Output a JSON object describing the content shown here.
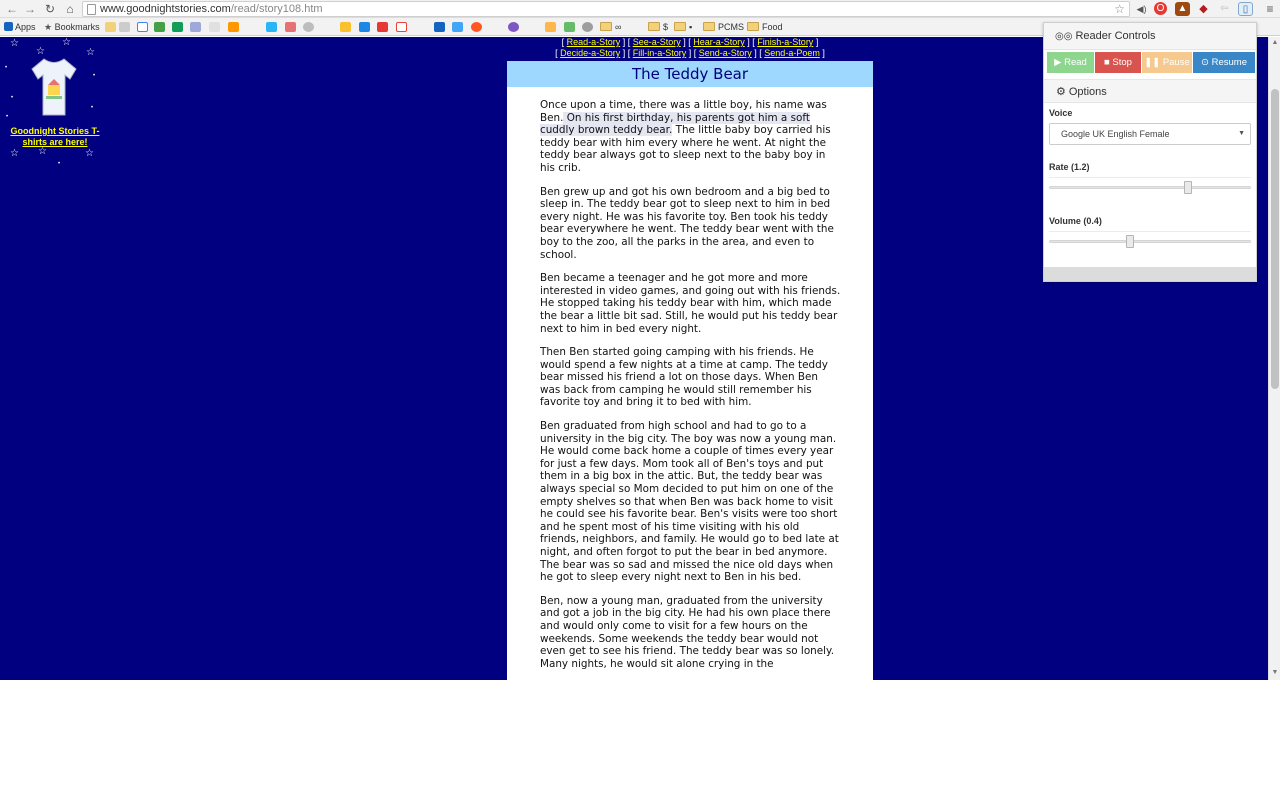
{
  "browser": {
    "url_domain": "www.goodnightstories.com",
    "url_path": "/read/story108.htm",
    "bookmarks": {
      "apps": "Apps",
      "bookmarks": "Bookmarks",
      "folder_dollar": "$",
      "folder_infinity": "∞",
      "folder_pcms": "PCMS",
      "folder_food": "Food"
    }
  },
  "sidebar": {
    "ad_text": "Goodnight Stories T-shirts are here!"
  },
  "nav": {
    "items": [
      "Read-a-Story",
      "See-a-Story",
      "Hear-a-Story",
      "Finish-a-Story",
      "Decide-a-Story",
      "Fill-in-a-Story",
      "Send-a-Story",
      "Send-a-Poem"
    ]
  },
  "story": {
    "title": "The Teddy Bear",
    "p1_a": "Once upon a time, there was a little boy, his name was Ben.",
    "p1_highlight": " On his first birthday, his parents got him a soft cuddly brown teddy bear.",
    "p1_b": " The little baby boy carried his teddy bear with him every where he went. At night the teddy bear always got to sleep next to the baby boy in his crib.",
    "p2": "Ben grew up and got his own bedroom and a big bed to sleep in. The teddy bear got to sleep next to him in bed every night. He was his favorite toy.  Ben took his teddy bear everywhere he went. The teddy bear went with the boy to the zoo, all the parks in the area, and even to school.",
    "p3": "Ben became a teenager and he got more and more interested in video games, and going out with his friends. He stopped taking his teddy bear with him, which made the bear a little bit sad. Still, he would put his teddy bear next to him in bed every night.",
    "p4": "Then Ben started going camping with his friends. He would spend a few nights at a time at camp. The teddy bear missed his friend a lot on those days. When Ben was back from camping he would still remember his favorite toy and bring it to bed with him.",
    "p5": "Ben graduated from high school and had to go to a university in the big city. The boy was now a young man.  He would come back home a couple of times every year for just a few days.  Mom took all of Ben's toys and put them in a big box in the attic.  But, the teddy bear was always special so Mom decided to put him on one of the empty shelves so that when Ben was back home to visit he could see his favorite bear. Ben's visits were too short and he spent most of his time visiting with his old friends, neighbors, and family. He would go to bed late at night, and often forgot to put the bear in bed anymore. The bear was so sad and missed the nice old days when he got to sleep every night next to Ben in his bed.",
    "p6": "Ben, now a young man, graduated from the university and got a job in the big city. He had his own place there and would only come to visit for a few hours on the weekends. Some weekends the teddy bear would not even get to see his friend. The teddy bear was so lonely.  Many nights, he would sit alone crying in the"
  },
  "reader": {
    "title": "Reader Controls",
    "read": "Read",
    "stop": "Stop",
    "pause": "Pause",
    "resume": "Resume",
    "options": "Options",
    "voice_label": "Voice",
    "voice_value": "Google UK English Female",
    "rate_label": "Rate (1.2)",
    "rate_fraction": 0.69,
    "volume_label": "Volume (0.4)",
    "volume_fraction": 0.4,
    "colors": {
      "read": "#8ed68e",
      "stop": "#d9534f",
      "pause": "#f6c98e",
      "resume": "#3a87c8"
    }
  }
}
